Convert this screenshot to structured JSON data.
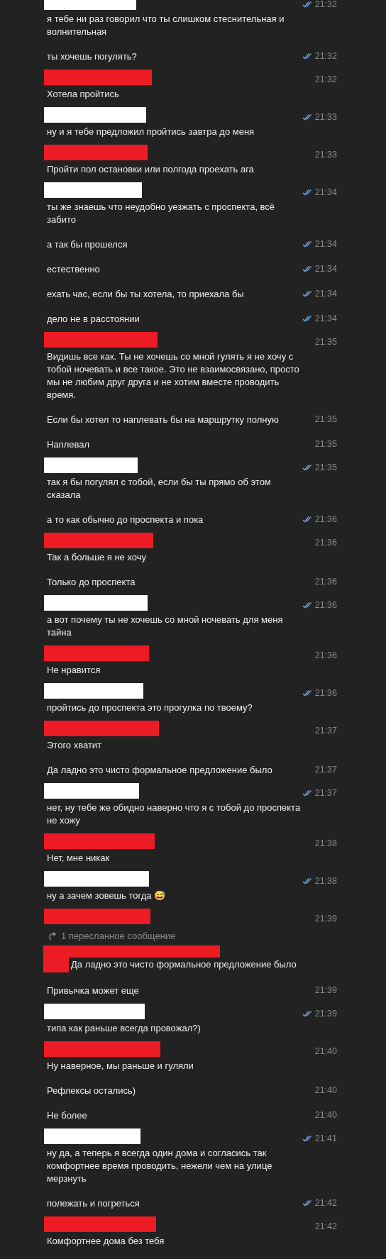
{
  "groups": [
    {
      "color": "#ffffff",
      "messages": [
        {
          "kind": "text",
          "text": "я тебе ни раз говорил что ты слишком стеснительная и волнительная",
          "time": "21:32",
          "read": true
        },
        {
          "kind": "text",
          "text": "ты хочешь погулять?",
          "time": "21:32",
          "read": true
        }
      ]
    },
    {
      "color": "#ed1c24",
      "messages": [
        {
          "kind": "text",
          "text": "Хотела пройтись",
          "time": "21:32",
          "read": false
        }
      ]
    },
    {
      "color": "#ffffff",
      "messages": [
        {
          "kind": "text",
          "text": "ну и я тебе предложил пройтись завтра до меня",
          "time": "21:33",
          "read": true
        }
      ]
    },
    {
      "color": "#ed1c24",
      "messages": [
        {
          "kind": "text",
          "text": "Пройти пол остановки или полгода проехать ага",
          "time": "21:33",
          "read": false
        }
      ]
    },
    {
      "color": "#ffffff",
      "messages": [
        {
          "kind": "text",
          "text": "ты же знаешь что неудобно уезжать с проспекта, всё забито",
          "time": "21:34",
          "read": true
        },
        {
          "kind": "text",
          "text": "а так бы прошелся",
          "time": "21:34",
          "read": true
        },
        {
          "kind": "text",
          "text": "естественно",
          "time": "21:34",
          "read": true
        },
        {
          "kind": "text",
          "text": "ехать час, если бы ты хотела, то приехала бы",
          "time": "21:34",
          "read": true
        },
        {
          "kind": "text",
          "text": "дело не в расстоянии",
          "time": "21:34",
          "read": true
        }
      ]
    },
    {
      "color": "#ed1c24",
      "messages": [
        {
          "kind": "text",
          "text": "Видишь все как. Ты не хочешь со мной гулять я не хочу с тобой ночевать и все такое. Это не взаимосвязано, просто мы не любим друг друга и не хотим вместе проводить время.",
          "time": "21:35",
          "read": false
        },
        {
          "kind": "text",
          "text": "Если бы хотел то наплевать бы на маршрутку полную",
          "time": "21:35",
          "read": false
        },
        {
          "kind": "text",
          "text": "Наплевал",
          "time": "21:35",
          "read": false
        }
      ]
    },
    {
      "color": "#ffffff",
      "messages": [
        {
          "kind": "text",
          "text": "так я бы погулял с тобой, если бы ты прямо об этом сказала",
          "time": "21:35",
          "read": true
        },
        {
          "kind": "text",
          "text": "а то как обычно до проспекта и пока",
          "time": "21:36",
          "read": true
        }
      ]
    },
    {
      "color": "#ed1c24",
      "messages": [
        {
          "kind": "text",
          "text": "Так а больше я не хочу",
          "time": "21:36",
          "read": false
        },
        {
          "kind": "text",
          "text": "Только до проспекта",
          "time": "21:36",
          "read": false
        }
      ]
    },
    {
      "color": "#ffffff",
      "messages": [
        {
          "kind": "text",
          "text": "а вот почему ты не хочешь со мной ночевать для меня тайна",
          "time": "21:36",
          "read": true
        }
      ]
    },
    {
      "color": "#ed1c24",
      "messages": [
        {
          "kind": "text",
          "text": "Не нравится",
          "time": "21:36",
          "read": false
        }
      ]
    },
    {
      "color": "#ffffff",
      "messages": [
        {
          "kind": "text",
          "text": "пройтись до проспекта это прогулка по твоему?",
          "time": "21:36",
          "read": true
        }
      ]
    },
    {
      "color": "#ed1c24",
      "messages": [
        {
          "kind": "text",
          "text": "Этого хватит",
          "time": "21:37",
          "read": false
        },
        {
          "kind": "text",
          "text": "Да ладно это чисто формальное предложение было",
          "time": "21:37",
          "read": false
        }
      ]
    },
    {
      "color": "#ffffff",
      "messages": [
        {
          "kind": "text",
          "text": "нет, ну тебе же обидно наверно что я с тобой до проспекта не хожу",
          "time": "21:37",
          "read": true
        }
      ]
    },
    {
      "color": "#ed1c24",
      "messages": [
        {
          "kind": "text",
          "text": "Нет, мне никак",
          "time": "21:38",
          "read": false
        }
      ]
    },
    {
      "color": "#ffffff",
      "messages": [
        {
          "kind": "text",
          "text": "ну а зачем зовешь тогда 😅",
          "time": "21:38",
          "read": true
        }
      ]
    },
    {
      "color": "#ed1c24",
      "messages": [
        {
          "kind": "forwarded",
          "forward_label": "1 пересланное сообщение",
          "text": "Да ладно это чисто формальное предложение было",
          "time": "21:39",
          "read": false
        },
        {
          "kind": "text",
          "text": "Привычка может еще",
          "time": "21:39",
          "read": false
        }
      ]
    },
    {
      "color": "#ffffff",
      "messages": [
        {
          "kind": "text",
          "text": "типа как раньше всегда провожал?)",
          "time": "21:39",
          "read": true
        }
      ]
    },
    {
      "color": "#ed1c24",
      "messages": [
        {
          "kind": "text",
          "text": "Ну наверное, мы раньше и гуляли",
          "time": "21:40",
          "read": false
        },
        {
          "kind": "text",
          "text": "Рефлексы остались)",
          "time": "21:40",
          "read": false
        },
        {
          "kind": "text",
          "text": "Не более",
          "time": "21:40",
          "read": false
        }
      ]
    },
    {
      "color": "#ffffff",
      "messages": [
        {
          "kind": "text",
          "text": "ну да, а теперь я всегда один дома и согласись так комфортнее время проводить, нежели чем на улице мерзнуть",
          "time": "21:41",
          "read": true
        },
        {
          "kind": "text",
          "text": "полежать и погреться",
          "time": "21:42",
          "read": true
        }
      ]
    },
    {
      "color": "#ed1c24",
      "messages": [
        {
          "kind": "text",
          "text": "Комфортнее дома без тебя",
          "time": "21:42",
          "read": false
        }
      ]
    }
  ]
}
